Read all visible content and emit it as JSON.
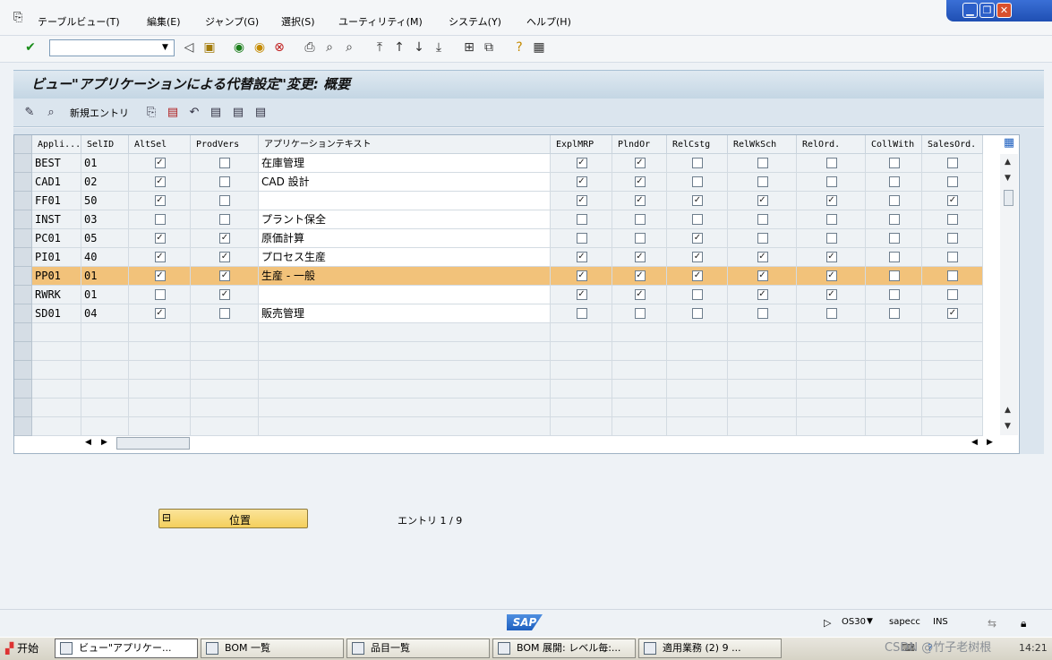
{
  "menu": [
    "テーブルビュー(T)",
    "編集(E)",
    "ジャンプ(G)",
    "選択(S)",
    "ユーティリティ(M)",
    "システム(Y)",
    "ヘルプ(H)"
  ],
  "title": "ビュー\"アプリケーションによる代替設定\"変更: 概要",
  "app_toolbar": {
    "new_entries": "新規エントリ"
  },
  "table": {
    "columns": [
      "Appli...",
      "SelID",
      "AltSel",
      "ProdVers",
      "アプリケーションテキスト",
      "ExplMRP",
      "PlndOr",
      "RelCstg",
      "RelWkSch",
      "RelOrd.",
      "CollWith",
      "SalesOrd."
    ],
    "rows": [
      {
        "appl": "BEST",
        "selid": "01",
        "altsel": true,
        "prodvers": false,
        "text": "在庫管理",
        "flags": [
          true,
          true,
          false,
          false,
          false,
          false,
          false
        ]
      },
      {
        "appl": "CAD1",
        "selid": "02",
        "altsel": true,
        "prodvers": false,
        "text": "CAD 設計",
        "flags": [
          true,
          true,
          false,
          false,
          false,
          false,
          false
        ]
      },
      {
        "appl": "FF01",
        "selid": "50",
        "altsel": true,
        "prodvers": false,
        "text": "",
        "flags": [
          true,
          true,
          true,
          true,
          true,
          false,
          true
        ]
      },
      {
        "appl": "INST",
        "selid": "03",
        "altsel": false,
        "prodvers": false,
        "text": "プラント保全",
        "flags": [
          false,
          false,
          false,
          false,
          false,
          false,
          false
        ]
      },
      {
        "appl": "PC01",
        "selid": "05",
        "altsel": true,
        "prodvers": true,
        "text": "原価計算",
        "flags": [
          false,
          false,
          true,
          false,
          false,
          false,
          false
        ]
      },
      {
        "appl": "PI01",
        "selid": "40",
        "altsel": true,
        "prodvers": true,
        "text": "プロセス生産",
        "flags": [
          true,
          true,
          true,
          true,
          true,
          false,
          false
        ]
      },
      {
        "appl": "PP01",
        "selid": "01",
        "altsel": true,
        "prodvers": true,
        "text": "生産 - 一般",
        "flags": [
          true,
          true,
          true,
          true,
          true,
          false,
          false
        ],
        "selected": true
      },
      {
        "appl": "RWRK",
        "selid": "01",
        "altsel": false,
        "prodvers": true,
        "text": "",
        "flags": [
          true,
          true,
          false,
          true,
          true,
          false,
          false
        ]
      },
      {
        "appl": "SD01",
        "selid": "04",
        "altsel": true,
        "prodvers": false,
        "text": "販売管理",
        "flags": [
          false,
          false,
          false,
          false,
          false,
          false,
          true
        ]
      }
    ]
  },
  "position_button": "位置",
  "entries_label": "エントリ 1 / 9",
  "status": {
    "tcode": "OS30",
    "server": "sapecc",
    "mode": "INS"
  },
  "taskbar": {
    "start": "开始",
    "tasks": [
      "ビュー\"アプリケー...",
      "BOM 一覧",
      "品目一覧",
      "BOM 展開: レベル毎:...",
      "適用業務 (2)  9 ..."
    ],
    "tray_watermark": "CSDN @竹子老树根",
    "clock": "14:21"
  },
  "colors": {
    "selected_row": "#f2c27a",
    "title_bg": "#c4d6e4",
    "header_bg": "#eef2f5"
  }
}
